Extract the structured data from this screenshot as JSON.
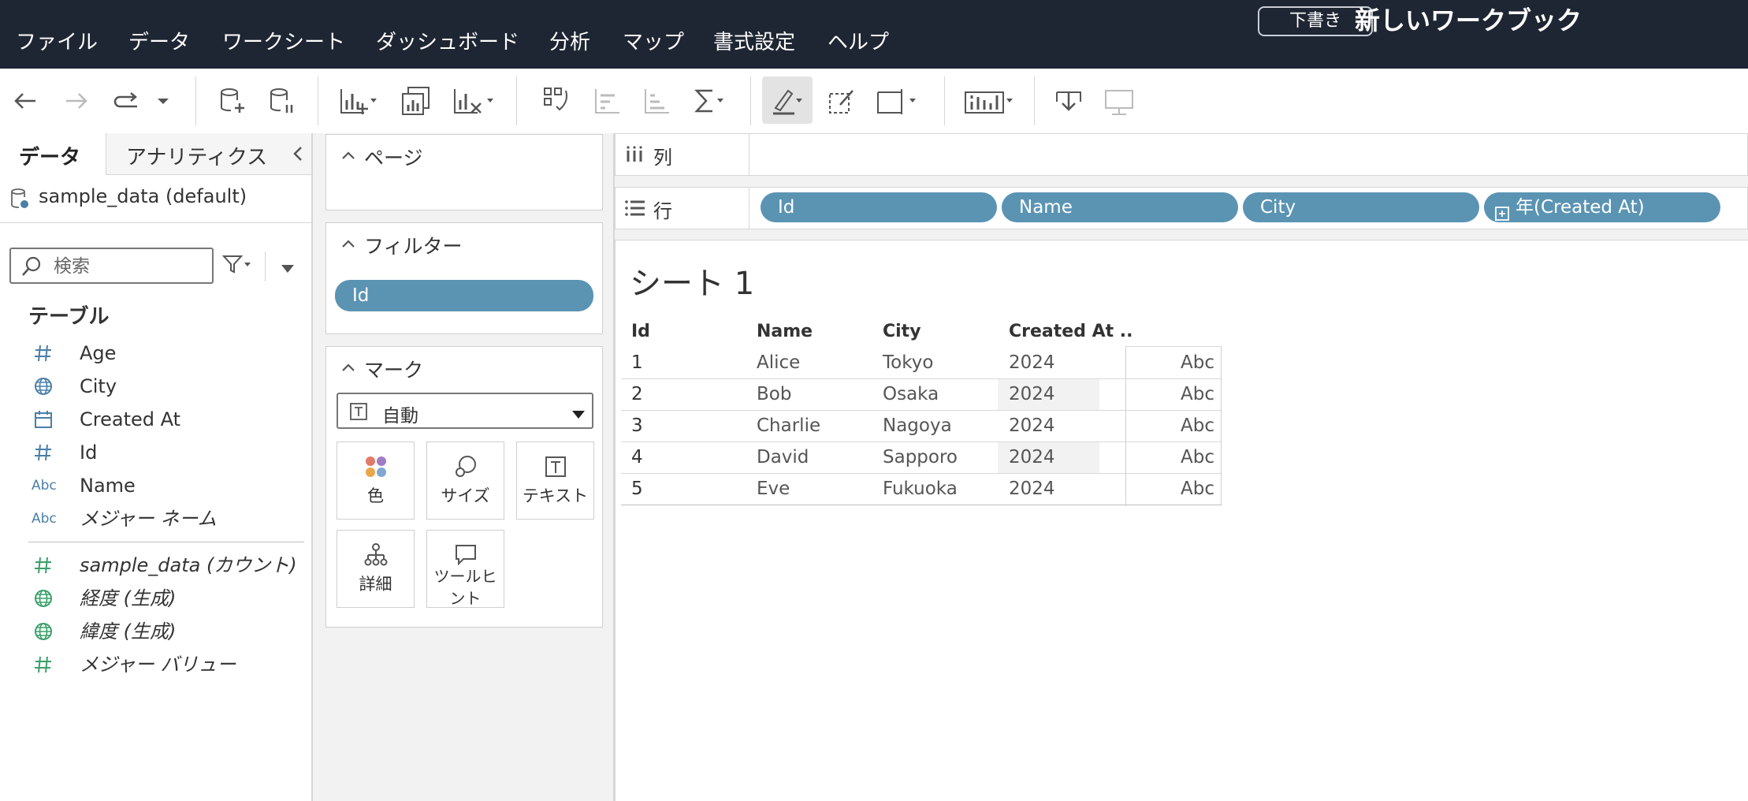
{
  "menu": {
    "items": [
      "ファイル",
      "データ",
      "ワークシート",
      "ダッシュボード",
      "分析",
      "マップ",
      "書式設定",
      "ヘルプ"
    ],
    "draft_badge": "下書き",
    "workbook_title": "新しいワークブック"
  },
  "toolbar": {
    "icons": [
      "back-icon",
      "forward-icon",
      "redo-icon",
      "dropdown-icon",
      "new-datasource-icon",
      "pause-updates-icon",
      "new-worksheet-icon",
      "duplicate-sheet-icon",
      "clear-sheet-icon",
      "swap-icon",
      "sort-ascending-icon",
      "sort-descending-icon",
      "sum-icon",
      "highlight-icon",
      "group-icon",
      "fit-icon",
      "show-me-icon",
      "download-icon",
      "presentation-icon"
    ]
  },
  "data_pane": {
    "tab_data": "データ",
    "tab_analytics": "アナリティクス",
    "datasource": "sample_data (default)",
    "search_placeholder": "検索",
    "tables_header": "テーブル",
    "dimensions": [
      {
        "icon": "#",
        "name": "Age"
      },
      {
        "icon": "globe",
        "name": "City"
      },
      {
        "icon": "calendar",
        "name": "Created At"
      },
      {
        "icon": "#",
        "name": "Id"
      },
      {
        "icon": "Abc",
        "name": "Name"
      },
      {
        "icon": "Abc",
        "name": "メジャー ネーム"
      }
    ],
    "measures": [
      {
        "icon": "#",
        "name": "sample_data (カウント)"
      },
      {
        "icon": "globe",
        "name": "経度 (生成)"
      },
      {
        "icon": "globe",
        "name": "緯度 (生成)"
      },
      {
        "icon": "#",
        "name": "メジャー バリュー"
      }
    ]
  },
  "cards": {
    "pages_title": "ページ",
    "filters_title": "フィルター",
    "filter_pills": [
      "Id"
    ],
    "marks_title": "マーク",
    "mark_type": "自動",
    "mark_buttons": [
      "色",
      "サイズ",
      "テキスト",
      "詳細",
      "ツールヒント"
    ]
  },
  "shelves": {
    "columns_label": "列",
    "rows_label": "行",
    "row_pills": [
      "Id",
      "Name",
      "City",
      "年(Created At)"
    ]
  },
  "sheet": {
    "title": "シート 1",
    "headers": [
      "Id",
      "Name",
      "City",
      "Created At .."
    ],
    "rows": [
      [
        "1",
        "Alice",
        "Tokyo",
        "2024",
        "Abc"
      ],
      [
        "2",
        "Bob",
        "Osaka",
        "2024",
        "Abc"
      ],
      [
        "3",
        "Charlie",
        "Nagoya",
        "2024",
        "Abc"
      ],
      [
        "4",
        "David",
        "Sapporo",
        "2024",
        "Abc"
      ],
      [
        "5",
        "Eve",
        "Fukuoka",
        "2024",
        "Abc"
      ]
    ]
  },
  "colors": {
    "menubar": "#1f2633",
    "pill": "#5b94b3",
    "field_icon_blue": "#4a7fa8",
    "field_icon_green": "#3aa06a"
  }
}
